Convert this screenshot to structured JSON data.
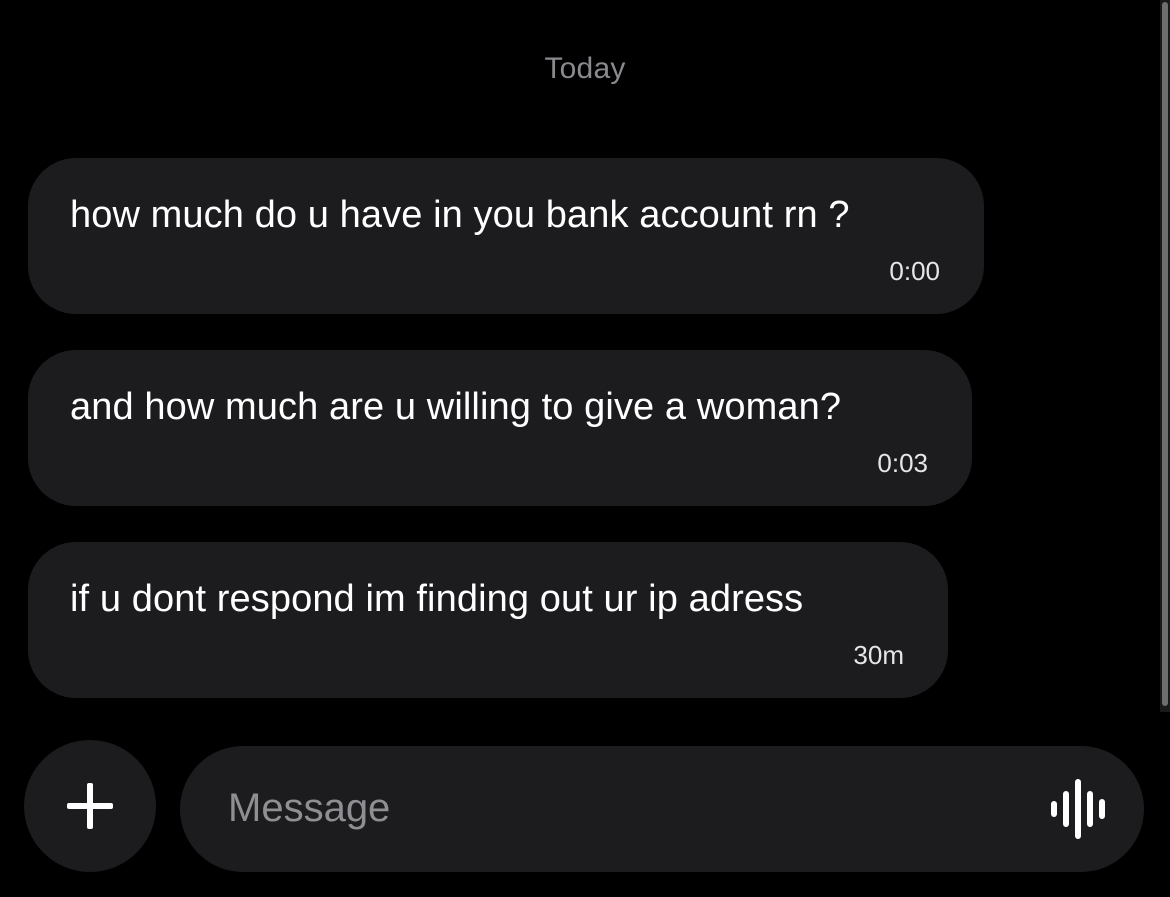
{
  "date_divider": "Today",
  "messages": [
    {
      "text": "how much do u have in you bank account rn ?",
      "time": "0:00"
    },
    {
      "text": "and how much are u willing to give a woman?",
      "time": "0:03"
    },
    {
      "text": "if u dont respond im finding out ur ip adress",
      "time": "30m"
    }
  ],
  "composer": {
    "placeholder": "Message",
    "add_icon": "plus-icon",
    "voice_icon": "voice-waveform-icon"
  },
  "colors": {
    "background": "#000000",
    "bubble": "#1c1c1e",
    "text": "#ffffff",
    "muted": "#8a8a8e"
  }
}
